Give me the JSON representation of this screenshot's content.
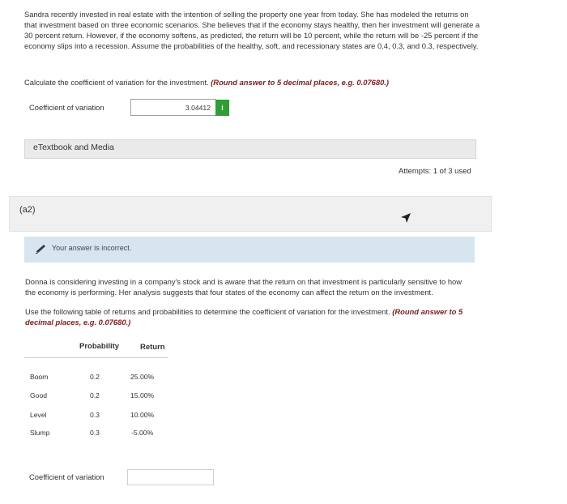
{
  "q1": {
    "paragraph": "Sandra recently invested in real estate with the intention of selling the property one year from today. She has modeled the returns on that investment based on three economic scenarios. She believes that if the economy stays healthy, then her investment will generate a 30 percent return. However, if the economy softens, as predicted, the return will be 10 percent, while the return will be -25 percent if the economy slips into a recession. Assume the probabilities of the healthy, soft, and recessionary states are 0.4, 0.3, and 0.3, respectively.",
    "instruction": "Calculate the coefficient of variation for the investment.",
    "round_note": "(Round answer to 5 decimal places, e.g. 0.07680.)",
    "field_label": "Coefficient of variation",
    "answer_value": "3.04412",
    "info_badge": "i",
    "etextbook": "eTextbook and Media",
    "attempts": "Attempts: 1 of 3 used"
  },
  "q2": {
    "section_label": "(a2)",
    "feedback": "Your answer is incorrect.",
    "paragraph": "Donna is considering investing in a company's stock and is aware that the return on that investment is particularly sensitive to how the economy is performing. Her analysis suggests that four states of the economy can affect the return on the investment.",
    "instruction": "Use the following table of returns and probabilities to determine the coefficient of variation for the investment.",
    "round_note": "(Round answer to 5 decimal places, e.g. 0.07680.)",
    "table": {
      "headers": [
        "Probability",
        "Return"
      ],
      "rows": [
        {
          "state": "Boom",
          "probability": "0.2",
          "return": "25.00%"
        },
        {
          "state": "Good",
          "probability": "0.2",
          "return": "15.00%"
        },
        {
          "state": "Level",
          "probability": "0.3",
          "return": "10.00%"
        },
        {
          "state": "Slump",
          "probability": "0.3",
          "return": "-5.00%"
        }
      ]
    },
    "field_label": "Coefficient of variation",
    "answer_value": ""
  },
  "colors": {
    "feedback_bg": "#d6e5f0",
    "info_green": "#2f9e34",
    "emphasis": "#7a1f1f"
  }
}
